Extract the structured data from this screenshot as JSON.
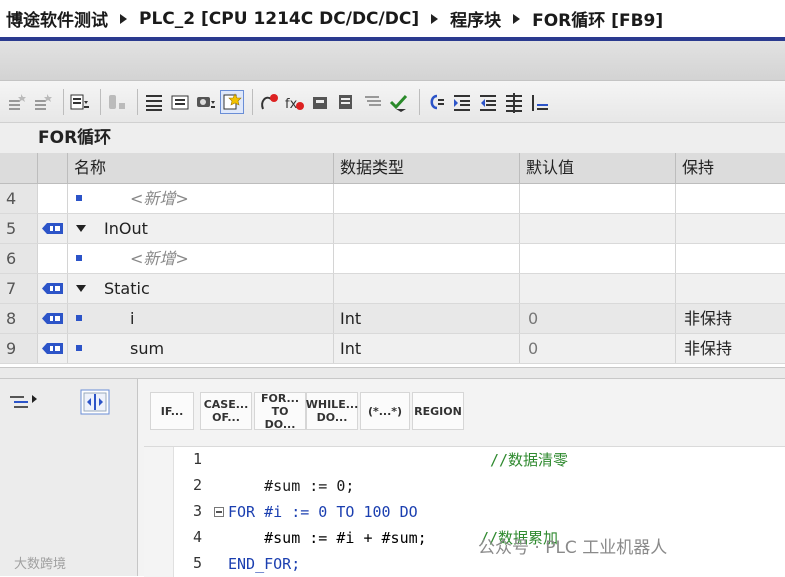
{
  "breadcrumb": [
    "博途软件测试",
    "PLC_2 [CPU 1214C DC/DC/DC]",
    "程序块",
    "FOR循环 [FB9]"
  ],
  "block_title": "FOR循环",
  "table": {
    "headers": [
      "名称",
      "数据类型",
      "默认值",
      "保持"
    ],
    "rows": [
      {
        "num": "4",
        "icon": "",
        "expand": false,
        "bullet": true,
        "name": "<新增>",
        "placeholder": true,
        "type": "",
        "default": "",
        "retain": ""
      },
      {
        "num": "5",
        "icon": "interface",
        "expand": true,
        "bullet": false,
        "name": "InOut",
        "placeholder": false,
        "type": "",
        "default": "",
        "retain": ""
      },
      {
        "num": "6",
        "icon": "",
        "expand": false,
        "bullet": true,
        "name": "<新增>",
        "placeholder": true,
        "type": "",
        "default": "",
        "retain": ""
      },
      {
        "num": "7",
        "icon": "interface",
        "expand": true,
        "bullet": false,
        "name": "Static",
        "placeholder": false,
        "type": "",
        "default": "",
        "retain": ""
      },
      {
        "num": "8",
        "icon": "interface",
        "expand": false,
        "bullet": true,
        "name": "i",
        "placeholder": false,
        "type": "Int",
        "default": "0",
        "retain": "非保持"
      },
      {
        "num": "9",
        "icon": "interface",
        "expand": false,
        "bullet": true,
        "name": "sum",
        "placeholder": false,
        "type": "Int",
        "default": "0",
        "retain": "非保持"
      }
    ]
  },
  "keywords": [
    "IF...",
    "CASE... OF...",
    "FOR... TO DO...",
    "WHILE... DO...",
    "(*...*)",
    "REGION"
  ],
  "code_lines": [
    {
      "num": "1",
      "text": "#sum := 0;",
      "comment": "//数据清零"
    },
    {
      "num": "2",
      "text": "",
      "comment": ""
    },
    {
      "num": "3",
      "text": "FOR #i := 0 TO 100 DO",
      "comment": ""
    },
    {
      "num": "4",
      "text": "    #sum := #i + #sum;",
      "comment": "//数据累加"
    },
    {
      "num": "5",
      "text": "END_FOR;",
      "comment": ""
    }
  ],
  "watermarks": [
    "公众号 · PLC 工业机器人",
    "大数跨境"
  ],
  "colors": {
    "title_accent": "#2a3a8f",
    "keyword": "#1b3fb0",
    "comment": "#2f8a2f",
    "interface_icon": "#2c54c8"
  }
}
